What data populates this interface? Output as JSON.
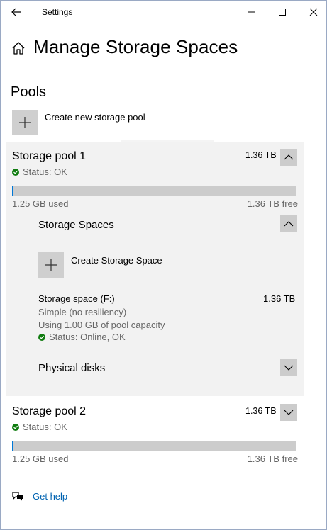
{
  "titlebar": {
    "title": "Settings",
    "back_icon": "back-arrow-icon",
    "minimize_icon": "minimize-icon",
    "maximize_icon": "maximize-icon",
    "close_icon": "close-icon"
  },
  "header": {
    "home_icon": "home-icon",
    "title": "Manage Storage Spaces"
  },
  "pools_section": {
    "title": "Pools",
    "create_pool_label": "Create new storage pool"
  },
  "pools": [
    {
      "name": "Storage pool 1",
      "status": "Status: OK",
      "size": "1.36 TB",
      "used": "1.25 GB used",
      "free": "1.36 TB free",
      "usage_fraction": 0.0009,
      "expanded": true,
      "storage_spaces": {
        "title": "Storage Spaces",
        "create_label": "Create Storage Space",
        "spaces": [
          {
            "name": "Storage space (F:)",
            "size": "1.36 TB",
            "resiliency": "Simple (no resiliency)",
            "capacity": "Using 1.00 GB of pool capacity",
            "status": "Status: Online, OK"
          }
        ]
      },
      "physical_disks": {
        "title": "Physical disks"
      }
    },
    {
      "name": "Storage pool 2",
      "status": "Status: OK",
      "size": "1.36 TB",
      "used": "1.25 GB used",
      "free": "1.36 TB free",
      "usage_fraction": 0.0009,
      "expanded": false
    }
  ],
  "help": {
    "label": "Get help",
    "icon": "help-chat-icon"
  },
  "colors": {
    "accent": "#0078d7",
    "link": "#0063b1",
    "status_ok": "#107c10",
    "panel": "#f2f2f2",
    "tile": "#cfcfcf"
  }
}
